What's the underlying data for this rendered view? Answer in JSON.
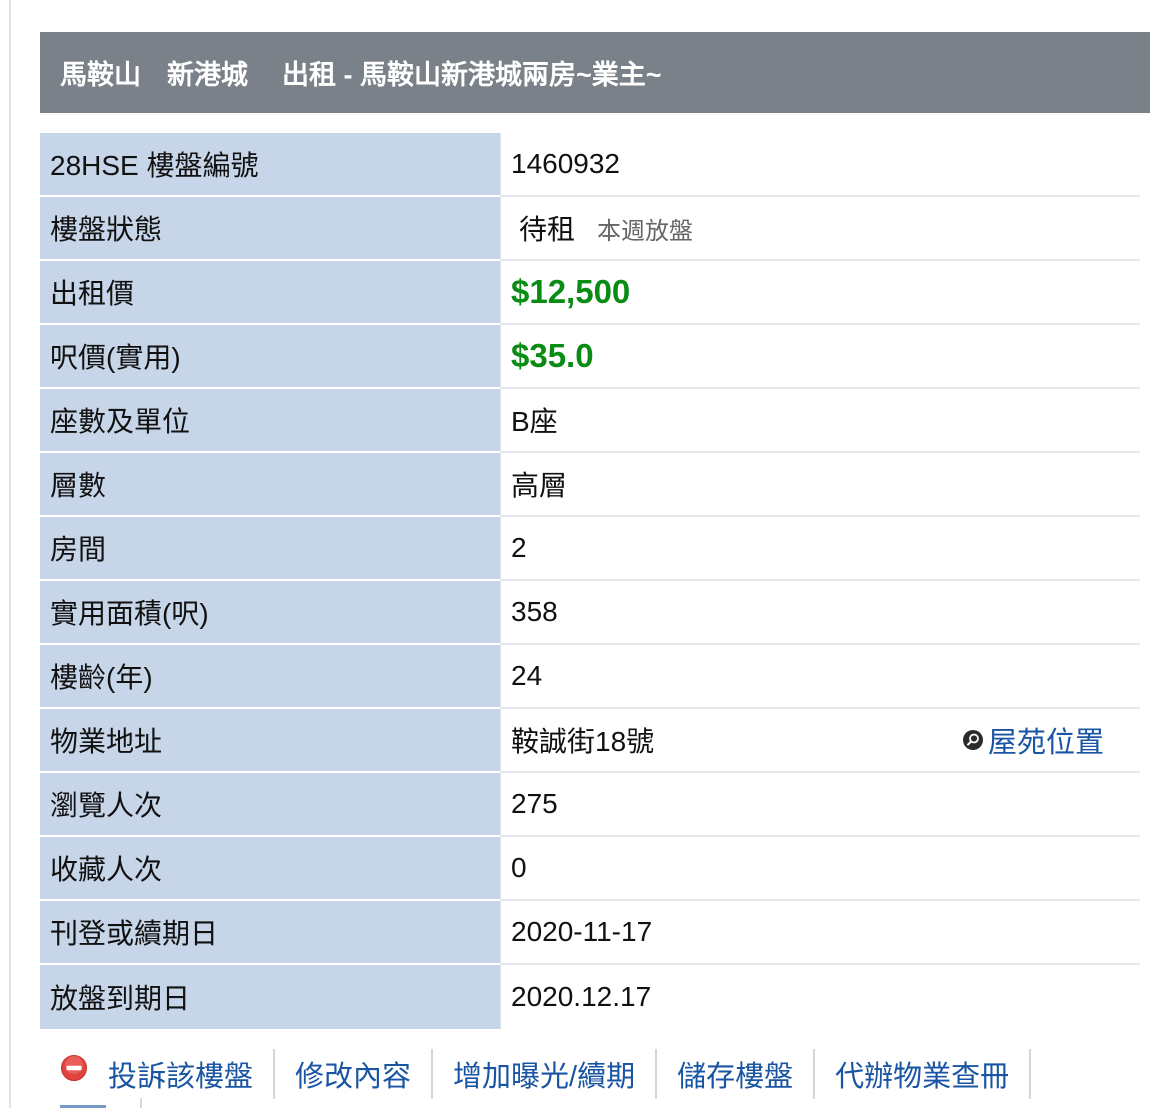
{
  "header": {
    "district": "馬鞍山",
    "estate": "新港城",
    "title": "出租 - 馬鞍山新港城兩房~業主~"
  },
  "details": {
    "listing_id": {
      "label": "28HSE 樓盤編號",
      "value": "1460932"
    },
    "status": {
      "label": "樓盤狀態",
      "value": "待租",
      "note": "本週放盤"
    },
    "rent_price": {
      "label": "出租價",
      "value": "$12,500"
    },
    "price_per_sqft": {
      "label": "呎價(實用)",
      "value": "$35.0"
    },
    "block_unit": {
      "label": "座數及單位",
      "value": "B座"
    },
    "floor": {
      "label": "層數",
      "value": "高層"
    },
    "rooms": {
      "label": "房間",
      "value": "2"
    },
    "saleable_area": {
      "label": "實用面積(呎)",
      "value": "358"
    },
    "building_age": {
      "label": "樓齡(年)",
      "value": "24"
    },
    "address": {
      "label": "物業地址",
      "value": "鞍誠街18號",
      "link_label": "屋苑位置",
      "link_icon": "map-search-icon"
    },
    "views": {
      "label": "瀏覽人次",
      "value": "275"
    },
    "favorites": {
      "label": "收藏人次",
      "value": "0"
    },
    "posted_date": {
      "label": "刊登或續期日",
      "value": "2020-11-17"
    },
    "expiry_date": {
      "label": "放盤到期日",
      "value": "2020.12.17"
    }
  },
  "actions": {
    "complain": {
      "label": "投訴該樓盤",
      "icon": "no-entry-icon"
    },
    "edit": {
      "label": "修改內容"
    },
    "boost_renew": {
      "label": "增加曝光/續期"
    },
    "save": {
      "label": "儲存樓盤"
    },
    "title_search": {
      "label": "代辦物業查冊"
    }
  },
  "colors": {
    "header_bg": "#7a8188",
    "label_bg": "#c6d5e7",
    "price_green": "#098c13",
    "link_blue": "#1a55a3",
    "complaint_red": "#e0443e"
  }
}
